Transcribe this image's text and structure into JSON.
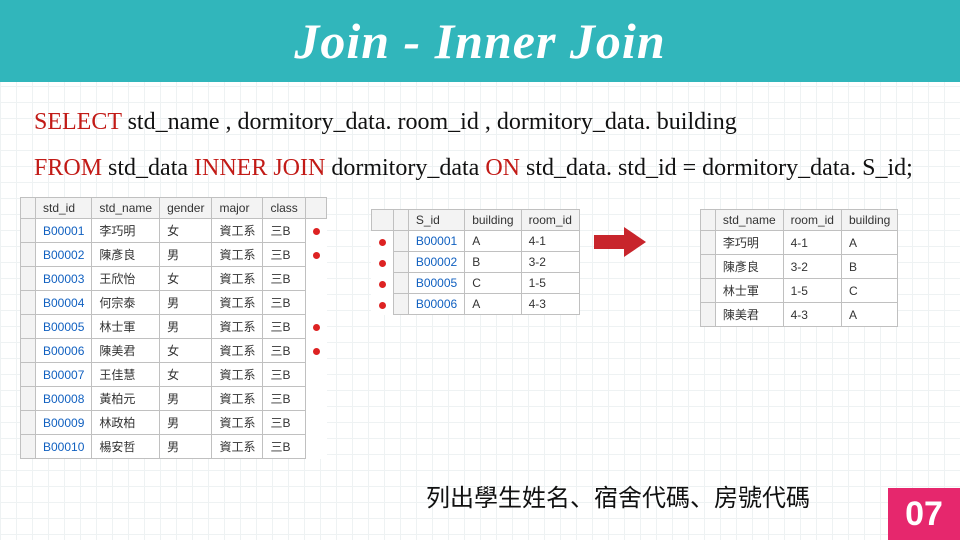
{
  "title": "Join - Inner Join",
  "sql": {
    "kw_select": "SELECT",
    "cols": " std_name , dormitory_data. room_id , dormitory_data. building",
    "kw_from": "FROM",
    "t1": " std_data ",
    "kw_ij": "INNER JOIN",
    "t2": " dormitory_data ",
    "kw_on": "ON",
    "cond": " std_data. std_id = dormitory_data. S_id;"
  },
  "left": {
    "headers": [
      "std_id",
      "std_name",
      "gender",
      "major",
      "class"
    ],
    "rows": [
      [
        "B00001",
        "李巧明",
        "女",
        "資工系",
        "三B"
      ],
      [
        "B00002",
        "陳彥良",
        "男",
        "資工系",
        "三B"
      ],
      [
        "B00003",
        "王欣怡",
        "女",
        "資工系",
        "三B"
      ],
      [
        "B00004",
        "何宗泰",
        "男",
        "資工系",
        "三B"
      ],
      [
        "B00005",
        "林士軍",
        "男",
        "資工系",
        "三B"
      ],
      [
        "B00006",
        "陳美君",
        "女",
        "資工系",
        "三B"
      ],
      [
        "B00007",
        "王佳慧",
        "女",
        "資工系",
        "三B"
      ],
      [
        "B00008",
        "黃柏元",
        "男",
        "資工系",
        "三B"
      ],
      [
        "B00009",
        "林政柏",
        "男",
        "資工系",
        "三B"
      ],
      [
        "B00010",
        "楊安哲",
        "男",
        "資工系",
        "三B"
      ]
    ]
  },
  "middle": {
    "headers": [
      "S_id",
      "building",
      "room_id"
    ],
    "rows": [
      [
        "B00001",
        "A",
        "4-1"
      ],
      [
        "B00002",
        "B",
        "3-2"
      ],
      [
        "B00005",
        "C",
        "1-5"
      ],
      [
        "B00006",
        "A",
        "4-3"
      ]
    ]
  },
  "right": {
    "headers": [
      "std_name",
      "room_id",
      "building"
    ],
    "rows": [
      [
        "李巧明",
        "4-1",
        "A"
      ],
      [
        "陳彥良",
        "3-2",
        "B"
      ],
      [
        "林士軍",
        "1-5",
        "C"
      ],
      [
        "陳美君",
        "4-3",
        "A"
      ]
    ]
  },
  "caption": "列出學生姓名、宿舍代碼、房號代碼",
  "badge": "07"
}
